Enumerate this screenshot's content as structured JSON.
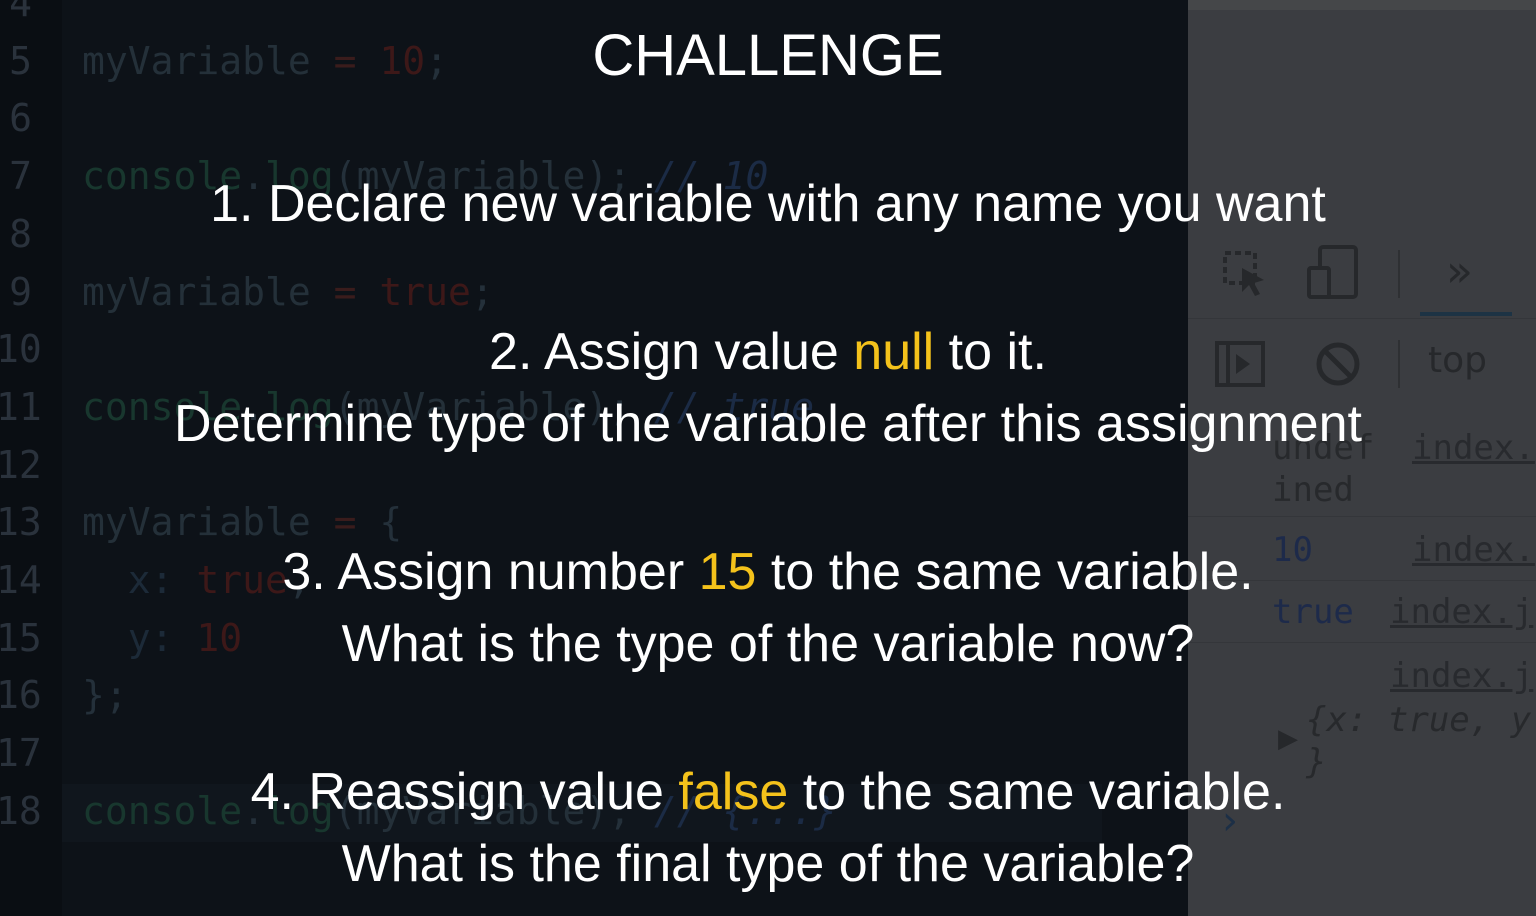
{
  "editor": {
    "lines": [
      {
        "num": "4",
        "parts": []
      },
      {
        "num": "5",
        "parts": [
          [
            "t-var",
            "myVariable"
          ],
          [
            "t-op",
            " = "
          ],
          [
            "t-num",
            "10"
          ],
          [
            "t-pun",
            ";"
          ]
        ]
      },
      {
        "num": "6",
        "parts": []
      },
      {
        "num": "7",
        "parts": [
          [
            "t-fn",
            "console"
          ],
          [
            "t-pun",
            "."
          ],
          [
            "t-fn",
            "log"
          ],
          [
            "t-pun",
            "("
          ],
          [
            "t-var",
            "myVariable"
          ],
          [
            "t-pun",
            ");"
          ],
          [
            "t-com",
            " // 10"
          ]
        ]
      },
      {
        "num": "8",
        "parts": []
      },
      {
        "num": "9",
        "parts": [
          [
            "t-var",
            "myVariable"
          ],
          [
            "t-op",
            " = "
          ],
          [
            "t-num",
            "true"
          ],
          [
            "t-pun",
            ";"
          ]
        ]
      },
      {
        "num": "10",
        "parts": []
      },
      {
        "num": "11",
        "parts": [
          [
            "t-fn",
            "console"
          ],
          [
            "t-pun",
            "."
          ],
          [
            "t-fn",
            "log"
          ],
          [
            "t-pun",
            "("
          ],
          [
            "t-var",
            "myVariable"
          ],
          [
            "t-pun",
            ");"
          ],
          [
            "t-com",
            " // true"
          ]
        ]
      },
      {
        "num": "12",
        "parts": []
      },
      {
        "num": "13",
        "parts": [
          [
            "t-var",
            "myVariable"
          ],
          [
            "t-op",
            " = "
          ],
          [
            "t-pun",
            "{"
          ]
        ]
      },
      {
        "num": "14",
        "parts": [
          [
            "t-key",
            "  x: "
          ],
          [
            "t-num",
            "true"
          ],
          [
            "t-pun",
            ","
          ]
        ]
      },
      {
        "num": "15",
        "parts": [
          [
            "t-key",
            "  y: "
          ],
          [
            "t-num",
            "10"
          ]
        ]
      },
      {
        "num": "16",
        "parts": [
          [
            "t-pun",
            "};"
          ]
        ]
      },
      {
        "num": "17",
        "parts": []
      },
      {
        "num": "18",
        "parts": [
          [
            "t-fn",
            "console"
          ],
          [
            "t-pun",
            "."
          ],
          [
            "t-fn",
            "log"
          ],
          [
            "t-pun",
            "("
          ],
          [
            "t-var",
            "myVariable"
          ],
          [
            "t-pun",
            ");"
          ],
          [
            "t-com",
            " // {...}"
          ]
        ]
      }
    ]
  },
  "devtools": {
    "more_tabs": "»",
    "context": "top",
    "console_rows": [
      {
        "value": "undef",
        "value2": "ined",
        "source": "index."
      },
      {
        "value": "10",
        "source": "index."
      },
      {
        "value": "true",
        "source": "index.j"
      },
      {
        "value": "",
        "source": "index.j"
      }
    ],
    "object_preview": "{x: true, y",
    "object_close": "}",
    "prompt": "›"
  },
  "challenge": {
    "title": "CHALLENGE",
    "task1": "1. Declare new variable with any name you want",
    "task2_pre": "2. Assign value ",
    "task2_hl": "null",
    "task2_post": " to it.",
    "task2_line2": "Determine type of the variable after this assignment",
    "task3_pre": "3. Assign number ",
    "task3_hl": "15",
    "task3_post": " to the same variable.",
    "task3_line2": "What is the type of the variable now?",
    "task4_pre": "4. Reassign value ",
    "task4_hl": "false",
    "task4_post": " to the same variable.",
    "task4_line2": "What is the final type of the variable?",
    "highlight_color": "#f4c21b"
  }
}
